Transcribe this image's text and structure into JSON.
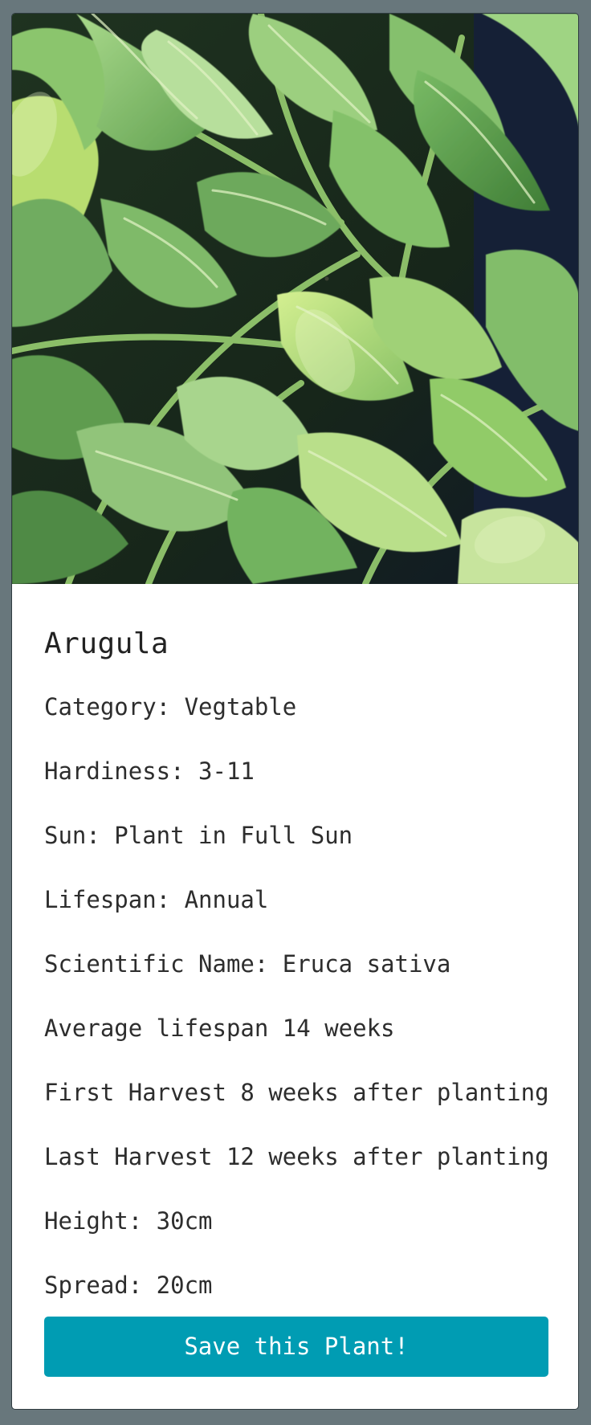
{
  "plant": {
    "name": "Arugula",
    "image_alt": "Arugula leaves",
    "facts": [
      "Category: Vegtable",
      "Hardiness: 3-11",
      "Sun: Plant in Full Sun",
      "Lifespan: Annual",
      "Scientific Name: Eruca sativa",
      "Average lifespan 14 weeks",
      "First Harvest 8 weeks after planting",
      "Last Harvest 12 weeks after planting",
      "Height: 30cm",
      "Spread: 20cm"
    ]
  },
  "actions": {
    "save_label": "Save this Plant!"
  },
  "colors": {
    "page_background": "#68777c",
    "card_background": "#ffffff",
    "button_background": "#009cb3",
    "button_text": "#ffffff",
    "text": "#2d2d2d"
  }
}
